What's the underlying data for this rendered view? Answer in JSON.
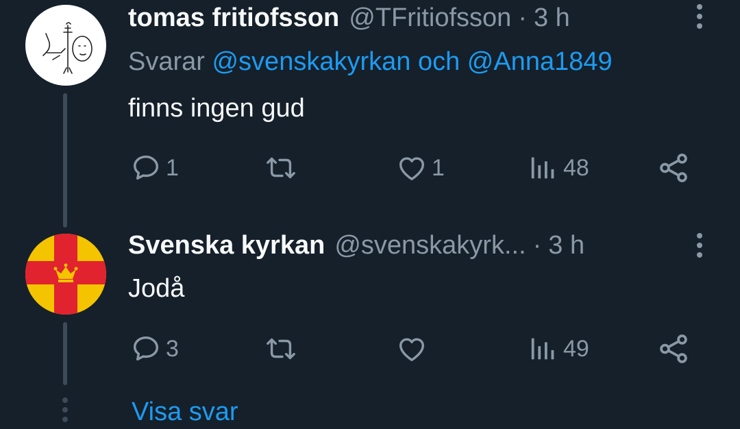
{
  "tweets": [
    {
      "author_name": "tomas fritiofsson",
      "handle": "@TFritiofsson",
      "separator": "·",
      "time": "3 h",
      "reply_prefix": "Svarar",
      "reply_mentions": "@svenskakyrkan och @Anna1849",
      "text": "finns ingen gud",
      "replies": "1",
      "retweets": "",
      "likes": "1",
      "views": "48"
    },
    {
      "author_name": "Svenska kyrkan",
      "handle": "@svenskakyrk...",
      "separator": "·",
      "time": "3 h",
      "text": "Jodå",
      "replies": "3",
      "retweets": "",
      "likes": "",
      "views": "49"
    }
  ],
  "show_replies_label": "Visa svar",
  "colors": {
    "background": "#15202b",
    "secondary_text": "#8b98a5",
    "link": "#1d9bf0",
    "thread_line": "#3d4a57"
  }
}
